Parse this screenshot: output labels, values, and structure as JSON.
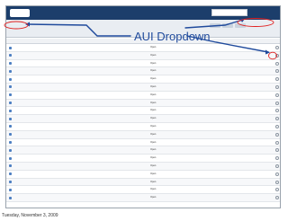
{
  "annotation": {
    "label": "AUI Dropdown"
  },
  "caption": "Tuesday, November 3, 2009",
  "colors": {
    "annotation": "#1f4a9c",
    "header": "#1c3e6b"
  },
  "rows": [
    {
      "status": "Open"
    },
    {
      "status": "Open"
    },
    {
      "status": "Open"
    },
    {
      "status": "Open"
    },
    {
      "status": "Open"
    },
    {
      "status": "Open"
    },
    {
      "status": "Open"
    },
    {
      "status": "Open"
    },
    {
      "status": "Open"
    },
    {
      "status": "Open"
    },
    {
      "status": "Open"
    },
    {
      "status": "Open"
    },
    {
      "status": "Open"
    },
    {
      "status": "Open"
    },
    {
      "status": "Open"
    },
    {
      "status": "Open"
    },
    {
      "status": "Open"
    },
    {
      "status": "Open"
    },
    {
      "status": "Open"
    },
    {
      "status": "Open"
    }
  ]
}
